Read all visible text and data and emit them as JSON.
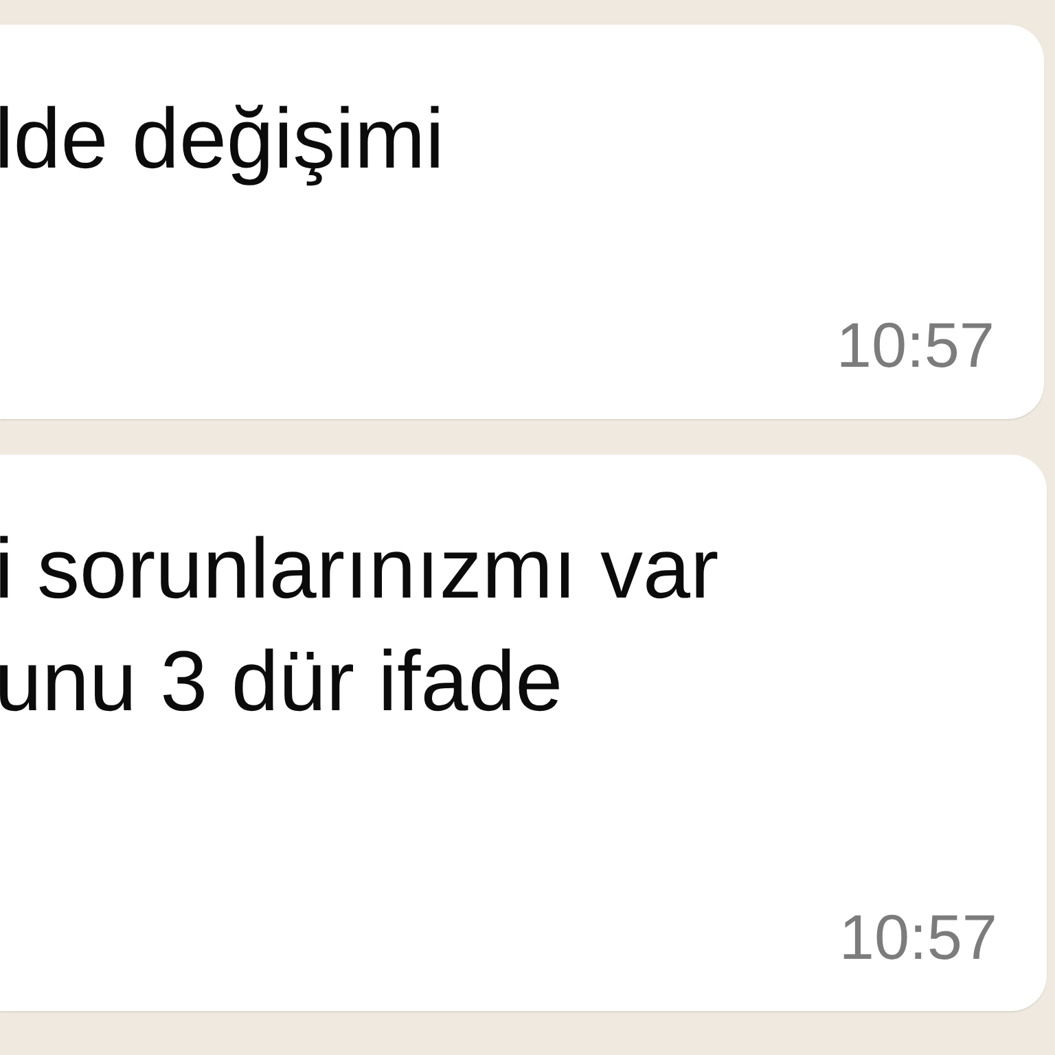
{
  "messages": [
    {
      "lines": [
        "lde değişimi"
      ],
      "time": "10:57"
    },
    {
      "lines": [
        "i sorunlarınızmı var",
        "unu 3 dür ifade"
      ],
      "time": "10:57"
    }
  ]
}
